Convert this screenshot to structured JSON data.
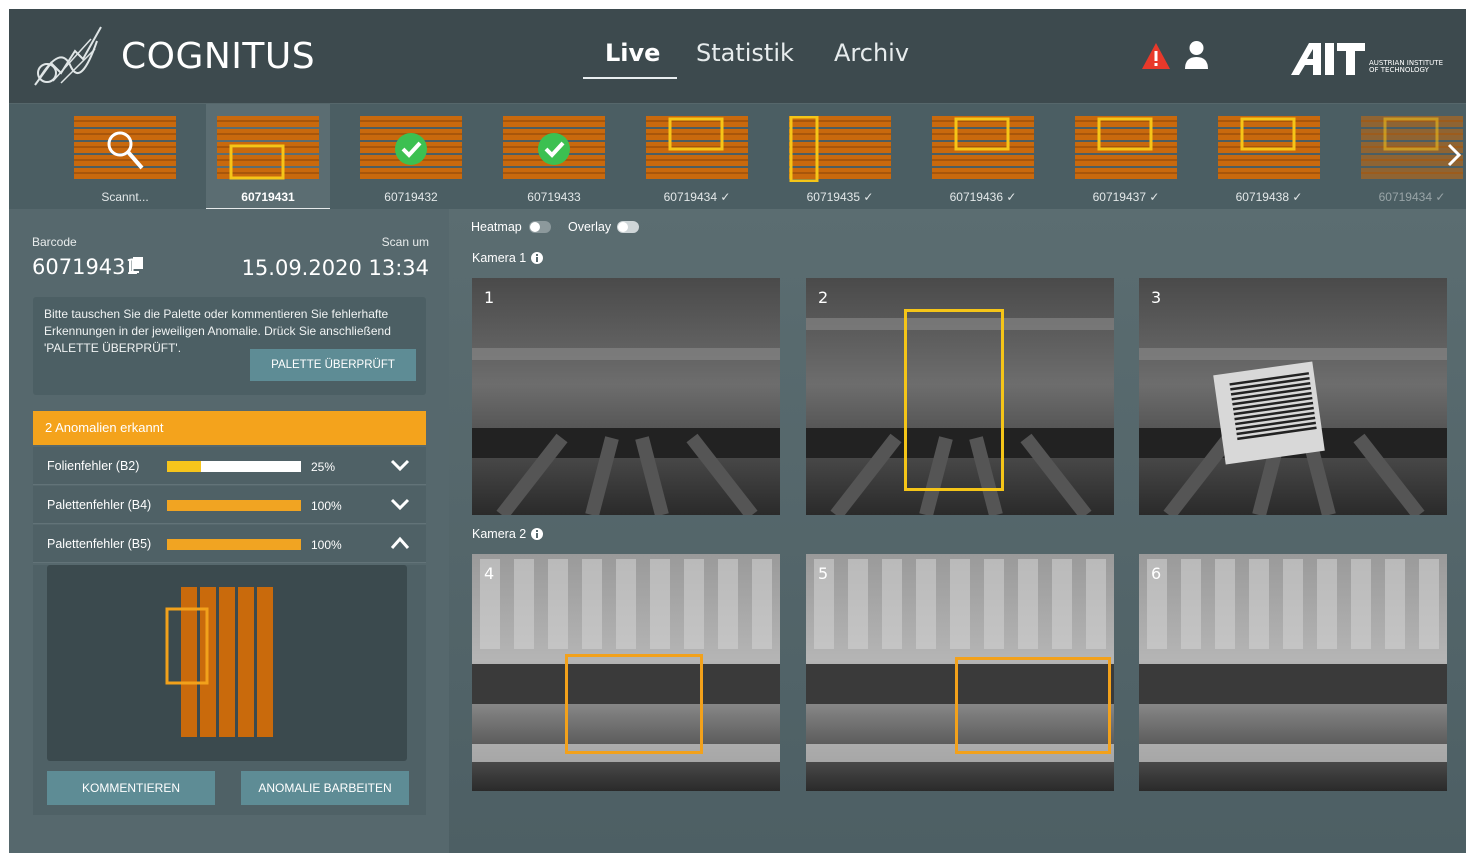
{
  "app": {
    "brand": "COGNITUS",
    "nav": {
      "live": "Live",
      "statistik": "Statistik",
      "archiv": "Archiv"
    },
    "logo_text": "AIT",
    "logo_sub": "AUSTRIAN INSTITUTE OF TECHNOLOGY"
  },
  "strip": {
    "items": [
      {
        "label": "Scannt..."
      },
      {
        "label": "60719431"
      },
      {
        "label": "60719432"
      },
      {
        "label": "60719433"
      },
      {
        "label": "60719434 ✓"
      },
      {
        "label": "60719435 ✓"
      },
      {
        "label": "60719436 ✓"
      },
      {
        "label": "60719437 ✓"
      },
      {
        "label": "60719438 ✓"
      },
      {
        "label": "60719434 ✓"
      }
    ]
  },
  "details": {
    "barcode_label": "Barcode",
    "barcode_value": "60719431",
    "scan_label": "Scan um",
    "scan_value": "15.09.2020 13:34",
    "info_text": "Bitte tauschen Sie die Palette oder kommentieren Sie fehlerhafte Erkennungen in der jeweiligen Anomalie. Drück Sie anschließend 'PALETTE ÜBERPRÜFT'.",
    "checked_button": "PALETTE ÜBERPRÜFT",
    "anomaly_header": "2 Anomalien erkannt",
    "anomalies": [
      {
        "name": "Folienfehler (B2)",
        "pct_label": "25%",
        "value": 0.25
      },
      {
        "name": "Palettenfehler (B4)",
        "pct_label": "100%",
        "value": 1.0
      },
      {
        "name": "Palettenfehler (B5)",
        "pct_label": "100%",
        "value": 1.0
      }
    ],
    "comment_button": "KOMMENTIEREN",
    "edit_button": "ANOMALIE BARBEITEN"
  },
  "cameras": {
    "heatmap_label": "Heatmap",
    "overlay_label": "Overlay",
    "heatmap_on": false,
    "overlay_on": true,
    "cam1_label": "Kamera 1",
    "cam2_label": "Kamera 2",
    "images": [
      "1",
      "2",
      "3",
      "4",
      "5",
      "6"
    ]
  },
  "colors": {
    "accent_orange": "#f4a31c",
    "box_yellow": "#f5c518",
    "button_teal": "#5e8c95",
    "alert_red": "#e8392a"
  }
}
